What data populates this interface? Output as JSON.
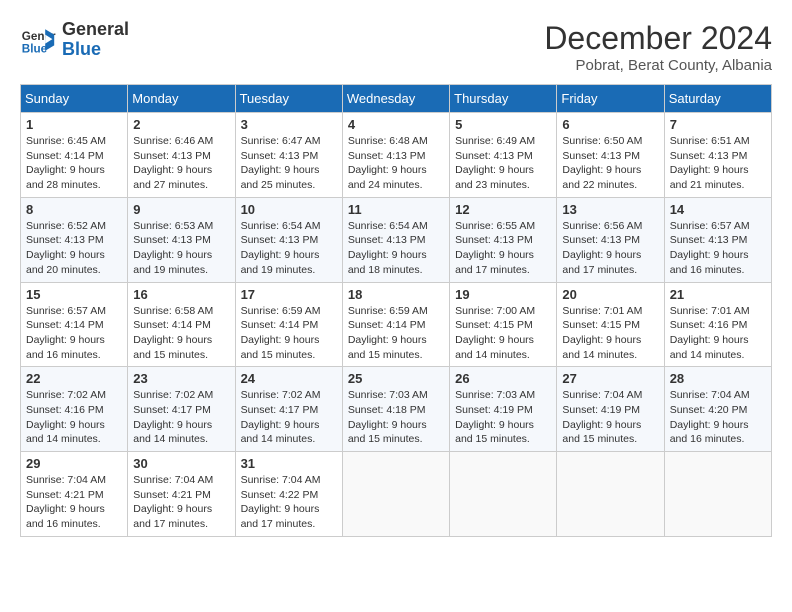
{
  "logo": {
    "text_general": "General",
    "text_blue": "Blue"
  },
  "title": "December 2024",
  "location": "Pobrat, Berat County, Albania",
  "weekdays": [
    "Sunday",
    "Monday",
    "Tuesday",
    "Wednesday",
    "Thursday",
    "Friday",
    "Saturday"
  ],
  "weeks": [
    [
      {
        "day": "1",
        "sunrise": "6:45 AM",
        "sunset": "4:14 PM",
        "daylight": "9 hours and 28 minutes."
      },
      {
        "day": "2",
        "sunrise": "6:46 AM",
        "sunset": "4:13 PM",
        "daylight": "9 hours and 27 minutes."
      },
      {
        "day": "3",
        "sunrise": "6:47 AM",
        "sunset": "4:13 PM",
        "daylight": "9 hours and 25 minutes."
      },
      {
        "day": "4",
        "sunrise": "6:48 AM",
        "sunset": "4:13 PM",
        "daylight": "9 hours and 24 minutes."
      },
      {
        "day": "5",
        "sunrise": "6:49 AM",
        "sunset": "4:13 PM",
        "daylight": "9 hours and 23 minutes."
      },
      {
        "day": "6",
        "sunrise": "6:50 AM",
        "sunset": "4:13 PM",
        "daylight": "9 hours and 22 minutes."
      },
      {
        "day": "7",
        "sunrise": "6:51 AM",
        "sunset": "4:13 PM",
        "daylight": "9 hours and 21 minutes."
      }
    ],
    [
      {
        "day": "8",
        "sunrise": "6:52 AM",
        "sunset": "4:13 PM",
        "daylight": "9 hours and 20 minutes."
      },
      {
        "day": "9",
        "sunrise": "6:53 AM",
        "sunset": "4:13 PM",
        "daylight": "9 hours and 19 minutes."
      },
      {
        "day": "10",
        "sunrise": "6:54 AM",
        "sunset": "4:13 PM",
        "daylight": "9 hours and 19 minutes."
      },
      {
        "day": "11",
        "sunrise": "6:54 AM",
        "sunset": "4:13 PM",
        "daylight": "9 hours and 18 minutes."
      },
      {
        "day": "12",
        "sunrise": "6:55 AM",
        "sunset": "4:13 PM",
        "daylight": "9 hours and 17 minutes."
      },
      {
        "day": "13",
        "sunrise": "6:56 AM",
        "sunset": "4:13 PM",
        "daylight": "9 hours and 17 minutes."
      },
      {
        "day": "14",
        "sunrise": "6:57 AM",
        "sunset": "4:13 PM",
        "daylight": "9 hours and 16 minutes."
      }
    ],
    [
      {
        "day": "15",
        "sunrise": "6:57 AM",
        "sunset": "4:14 PM",
        "daylight": "9 hours and 16 minutes."
      },
      {
        "day": "16",
        "sunrise": "6:58 AM",
        "sunset": "4:14 PM",
        "daylight": "9 hours and 15 minutes."
      },
      {
        "day": "17",
        "sunrise": "6:59 AM",
        "sunset": "4:14 PM",
        "daylight": "9 hours and 15 minutes."
      },
      {
        "day": "18",
        "sunrise": "6:59 AM",
        "sunset": "4:14 PM",
        "daylight": "9 hours and 15 minutes."
      },
      {
        "day": "19",
        "sunrise": "7:00 AM",
        "sunset": "4:15 PM",
        "daylight": "9 hours and 14 minutes."
      },
      {
        "day": "20",
        "sunrise": "7:01 AM",
        "sunset": "4:15 PM",
        "daylight": "9 hours and 14 minutes."
      },
      {
        "day": "21",
        "sunrise": "7:01 AM",
        "sunset": "4:16 PM",
        "daylight": "9 hours and 14 minutes."
      }
    ],
    [
      {
        "day": "22",
        "sunrise": "7:02 AM",
        "sunset": "4:16 PM",
        "daylight": "9 hours and 14 minutes."
      },
      {
        "day": "23",
        "sunrise": "7:02 AM",
        "sunset": "4:17 PM",
        "daylight": "9 hours and 14 minutes."
      },
      {
        "day": "24",
        "sunrise": "7:02 AM",
        "sunset": "4:17 PM",
        "daylight": "9 hours and 14 minutes."
      },
      {
        "day": "25",
        "sunrise": "7:03 AM",
        "sunset": "4:18 PM",
        "daylight": "9 hours and 15 minutes."
      },
      {
        "day": "26",
        "sunrise": "7:03 AM",
        "sunset": "4:19 PM",
        "daylight": "9 hours and 15 minutes."
      },
      {
        "day": "27",
        "sunrise": "7:04 AM",
        "sunset": "4:19 PM",
        "daylight": "9 hours and 15 minutes."
      },
      {
        "day": "28",
        "sunrise": "7:04 AM",
        "sunset": "4:20 PM",
        "daylight": "9 hours and 16 minutes."
      }
    ],
    [
      {
        "day": "29",
        "sunrise": "7:04 AM",
        "sunset": "4:21 PM",
        "daylight": "9 hours and 16 minutes."
      },
      {
        "day": "30",
        "sunrise": "7:04 AM",
        "sunset": "4:21 PM",
        "daylight": "9 hours and 17 minutes."
      },
      {
        "day": "31",
        "sunrise": "7:04 AM",
        "sunset": "4:22 PM",
        "daylight": "9 hours and 17 minutes."
      },
      null,
      null,
      null,
      null
    ]
  ]
}
